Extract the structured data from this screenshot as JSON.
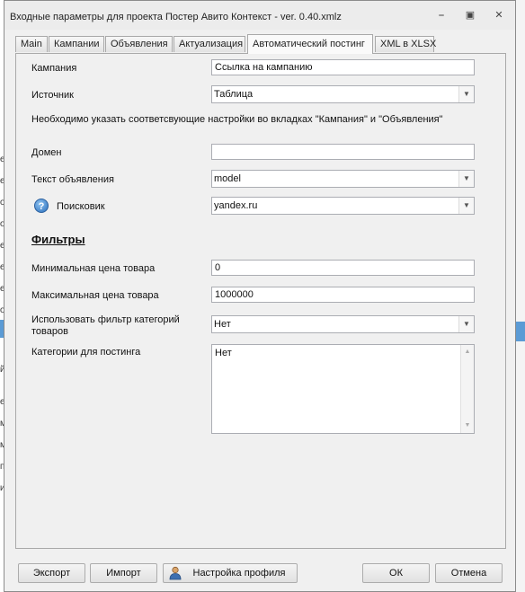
{
  "window": {
    "title": "Входные параметры для проекта Постер Авито Контекст - ver. 0.40.xmlz",
    "controls": {
      "minimize": "⎯",
      "maximize": "▣",
      "close": "✕"
    }
  },
  "tabs": [
    {
      "label": "Main"
    },
    {
      "label": "Кампании"
    },
    {
      "label": "Объявления"
    },
    {
      "label": "Актуализация"
    },
    {
      "label": "Автоматический постинг",
      "active": true
    },
    {
      "label": "XML в XLSX"
    }
  ],
  "form": {
    "campaign_label": "Кампания",
    "campaign_value": "Ссылка на кампанию",
    "source_label": "Источник",
    "source_value": "Таблица",
    "note": "Необходимо указать соответсвующие настройки во вкладках  \"Кампания\" и \"Объявления\"",
    "domain_label": "Домен",
    "domain_value": "",
    "adtext_label": "Текст объявления",
    "adtext_value": "model",
    "help_glyph": "?",
    "search_label": "Поисковик",
    "search_value": "yandex.ru",
    "filters_heading": "Фильтры",
    "minprice_label": "Минимальная цена товара",
    "minprice_value": "0",
    "maxprice_label": "Максимальная цена товара",
    "maxprice_value": "1000000",
    "catfilter_label_1": "Использовать фильтр категорий",
    "catfilter_label_2": "товаров",
    "catfilter_value": "Нет",
    "categories_label": "Категории для постинга",
    "categories_value": "Нет"
  },
  "buttons": {
    "export": "Экспорт",
    "import": "Импорт",
    "profile": "Настройка профиля",
    "ok": "ОК",
    "cancel": "Отмена"
  },
  "icons": {
    "dropdown": "chevron-down-icon",
    "help": "help-icon",
    "profile": "user-icon"
  },
  "colors": {
    "accent": "#5b9bd5",
    "help_icon": "#2a6fbd"
  },
  "background_left_fragments": [
    "е",
    "е",
    "о",
    "о",
    "е",
    "е",
    "е",
    "о",
    "й",
    "е",
    "м",
    "м",
    "п",
    "и"
  ]
}
